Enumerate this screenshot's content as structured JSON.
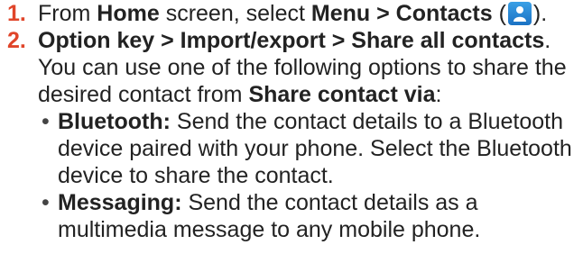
{
  "steps": [
    {
      "number": "1.",
      "segments": {
        "t1": "From ",
        "b1": "Home",
        "t2": " screen, select ",
        "b2": "Menu > Contacts",
        "t3": " (",
        "t4": ")."
      },
      "icon": "contacts-icon"
    },
    {
      "number": "2.",
      "segments": {
        "b1": "Option key > Import/export  > Share all contacts",
        "t1": ". You can use one of the following options to share the desired contact from ",
        "b2": "Share contact via",
        "t2": ":"
      },
      "bullets": [
        {
          "label": "Bluetooth:",
          "text": " Send the contact details to a Bluetooth device paired with your phone. Select the Bluetooth device to share the contact."
        },
        {
          "label": "Messaging:",
          "text": " Send the contact details as a multimedia message to any mobile phone."
        }
      ]
    }
  ],
  "colors": {
    "step_number": "#e0452a",
    "text": "#222222",
    "icon_bg": "#1b72c4"
  }
}
